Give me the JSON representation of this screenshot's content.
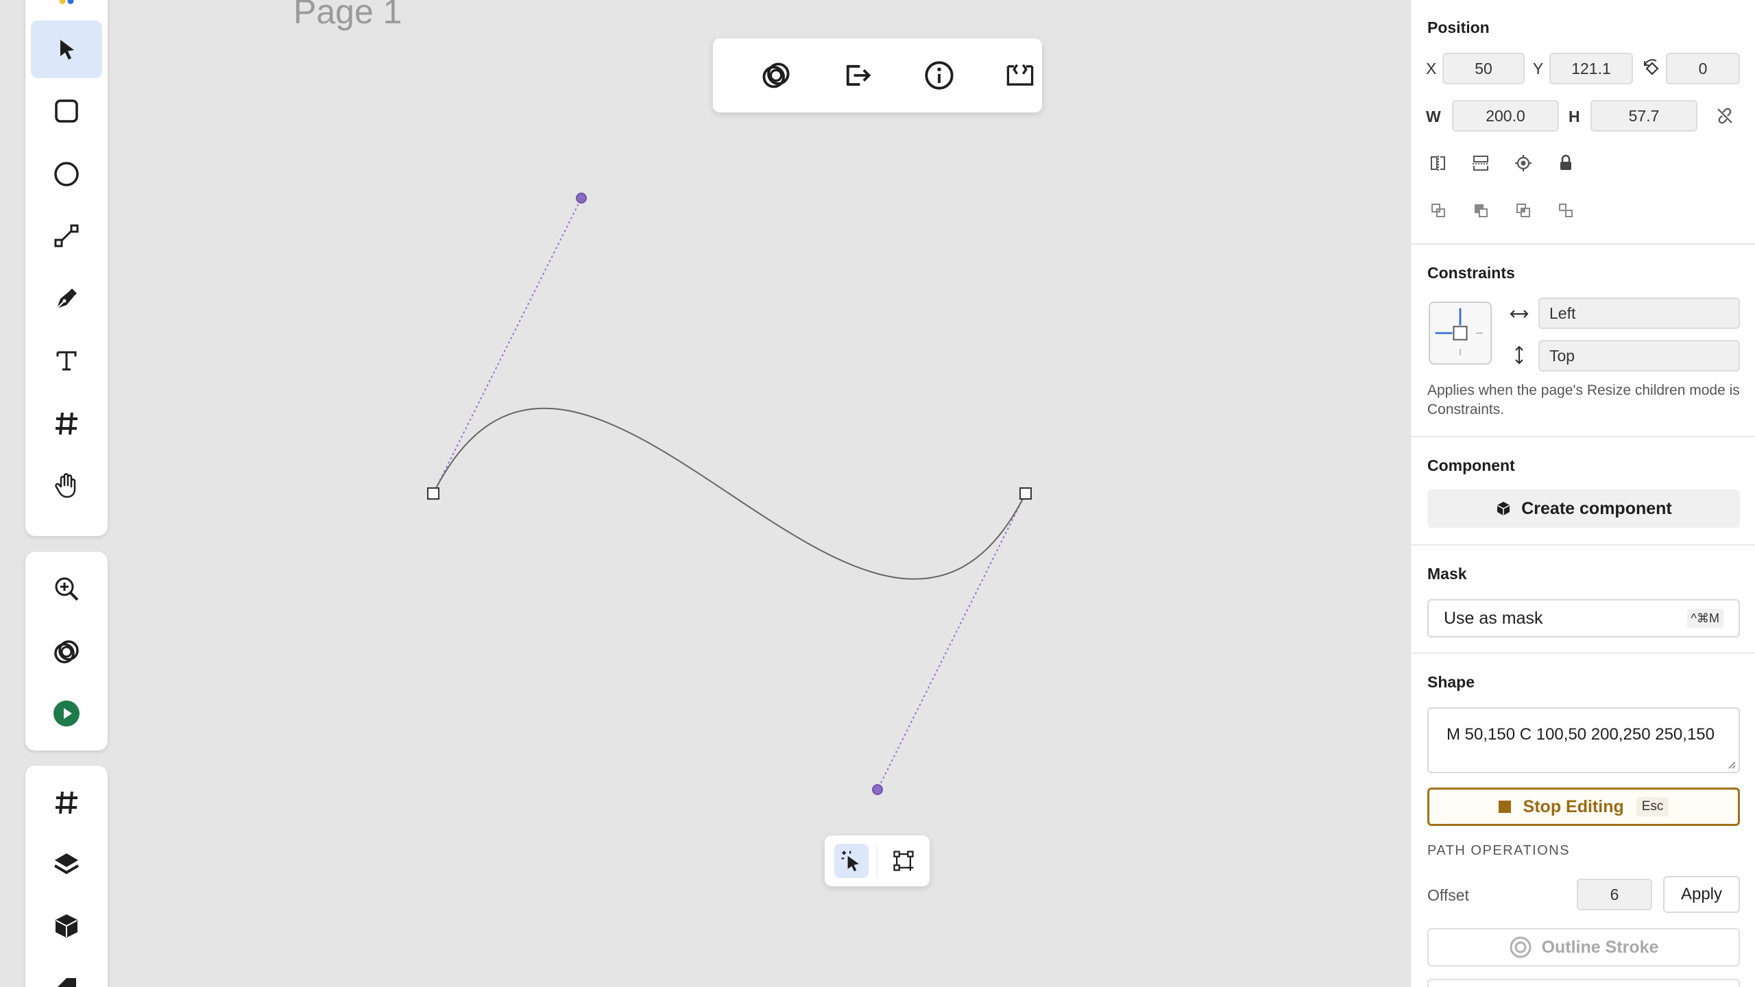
{
  "canvas": {
    "page_title": "Page 1"
  },
  "left_tools": {
    "primary": [
      "logo",
      "select",
      "rectangle",
      "ellipse",
      "line",
      "pen",
      "text",
      "frame",
      "hand"
    ],
    "secondary": [
      "zoom",
      "boolean",
      "play"
    ],
    "tertiary": [
      "frame",
      "layers",
      "components",
      "assets"
    ]
  },
  "floating_toolbar": {
    "items": [
      "boolean-ops",
      "export",
      "info",
      "code"
    ]
  },
  "mini_toolbar": {
    "items": [
      "select-points",
      "transform"
    ]
  },
  "panel": {
    "position": {
      "title": "Position",
      "x_label": "X",
      "x_value": "50",
      "y_label": "Y",
      "y_value": "121.1",
      "rotation_value": "0",
      "w_label": "W",
      "w_value": "200.0",
      "h_label": "H",
      "h_value": "57.7"
    },
    "constraints": {
      "title": "Constraints",
      "horizontal": "Left",
      "vertical": "Top",
      "note": "Applies when the page's Resize children mode is Constraints."
    },
    "component": {
      "title": "Component",
      "create_label": "Create component"
    },
    "mask": {
      "title": "Mask",
      "use_label": "Use as mask",
      "shortcut": "^⌘M"
    },
    "shape": {
      "title": "Shape",
      "path_value": "M 50,150 C 100,50 200,250 250,150",
      "stop_label": "Stop Editing",
      "stop_shortcut": "Esc"
    },
    "path_operations": {
      "title": "PATH OPERATIONS",
      "offset_label": "Offset",
      "offset_value": "6",
      "apply_label": "Apply",
      "outline_label": "Outline Stroke"
    }
  },
  "colors": {
    "canvas_bg": "#e5e5e5",
    "active_tool_bg": "#dde7fa",
    "curve_stroke": "#666666",
    "handle_line": "#9b6fd6",
    "handle_point": "#7d63b8",
    "stop_editing_accent": "#a0711a",
    "play_green": "#1e7a4a"
  }
}
